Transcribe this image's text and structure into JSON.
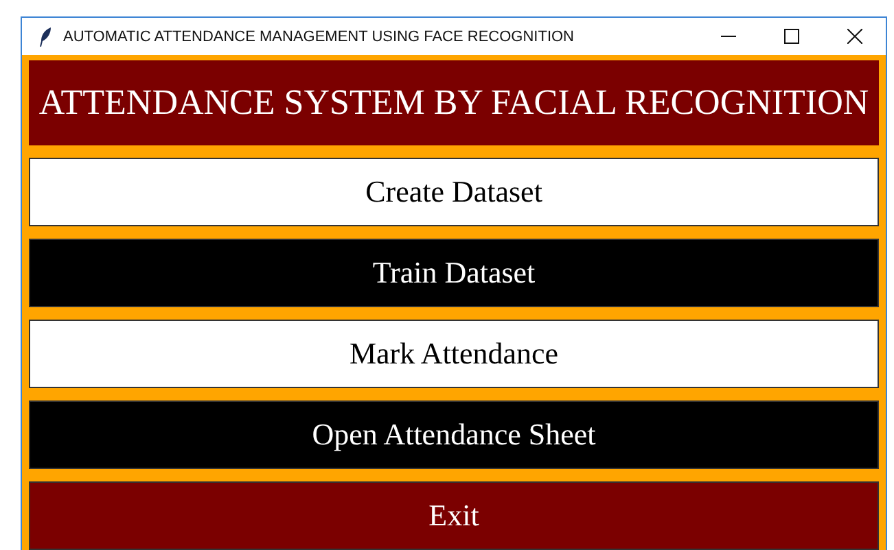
{
  "window": {
    "title": "AUTOMATIC ATTENDANCE MANAGEMENT USING FACE RECOGNITION"
  },
  "header": {
    "title": "ATTENDANCE SYSTEM BY FACIAL RECOGNITION"
  },
  "buttons": [
    {
      "label": "Create Dataset",
      "kind": "light"
    },
    {
      "label": "Train Dataset",
      "kind": "dark"
    },
    {
      "label": "Mark Attendance",
      "kind": "light"
    },
    {
      "label": "Open Attendance Sheet",
      "kind": "dark"
    },
    {
      "label": "Exit",
      "kind": "maroon"
    }
  ]
}
